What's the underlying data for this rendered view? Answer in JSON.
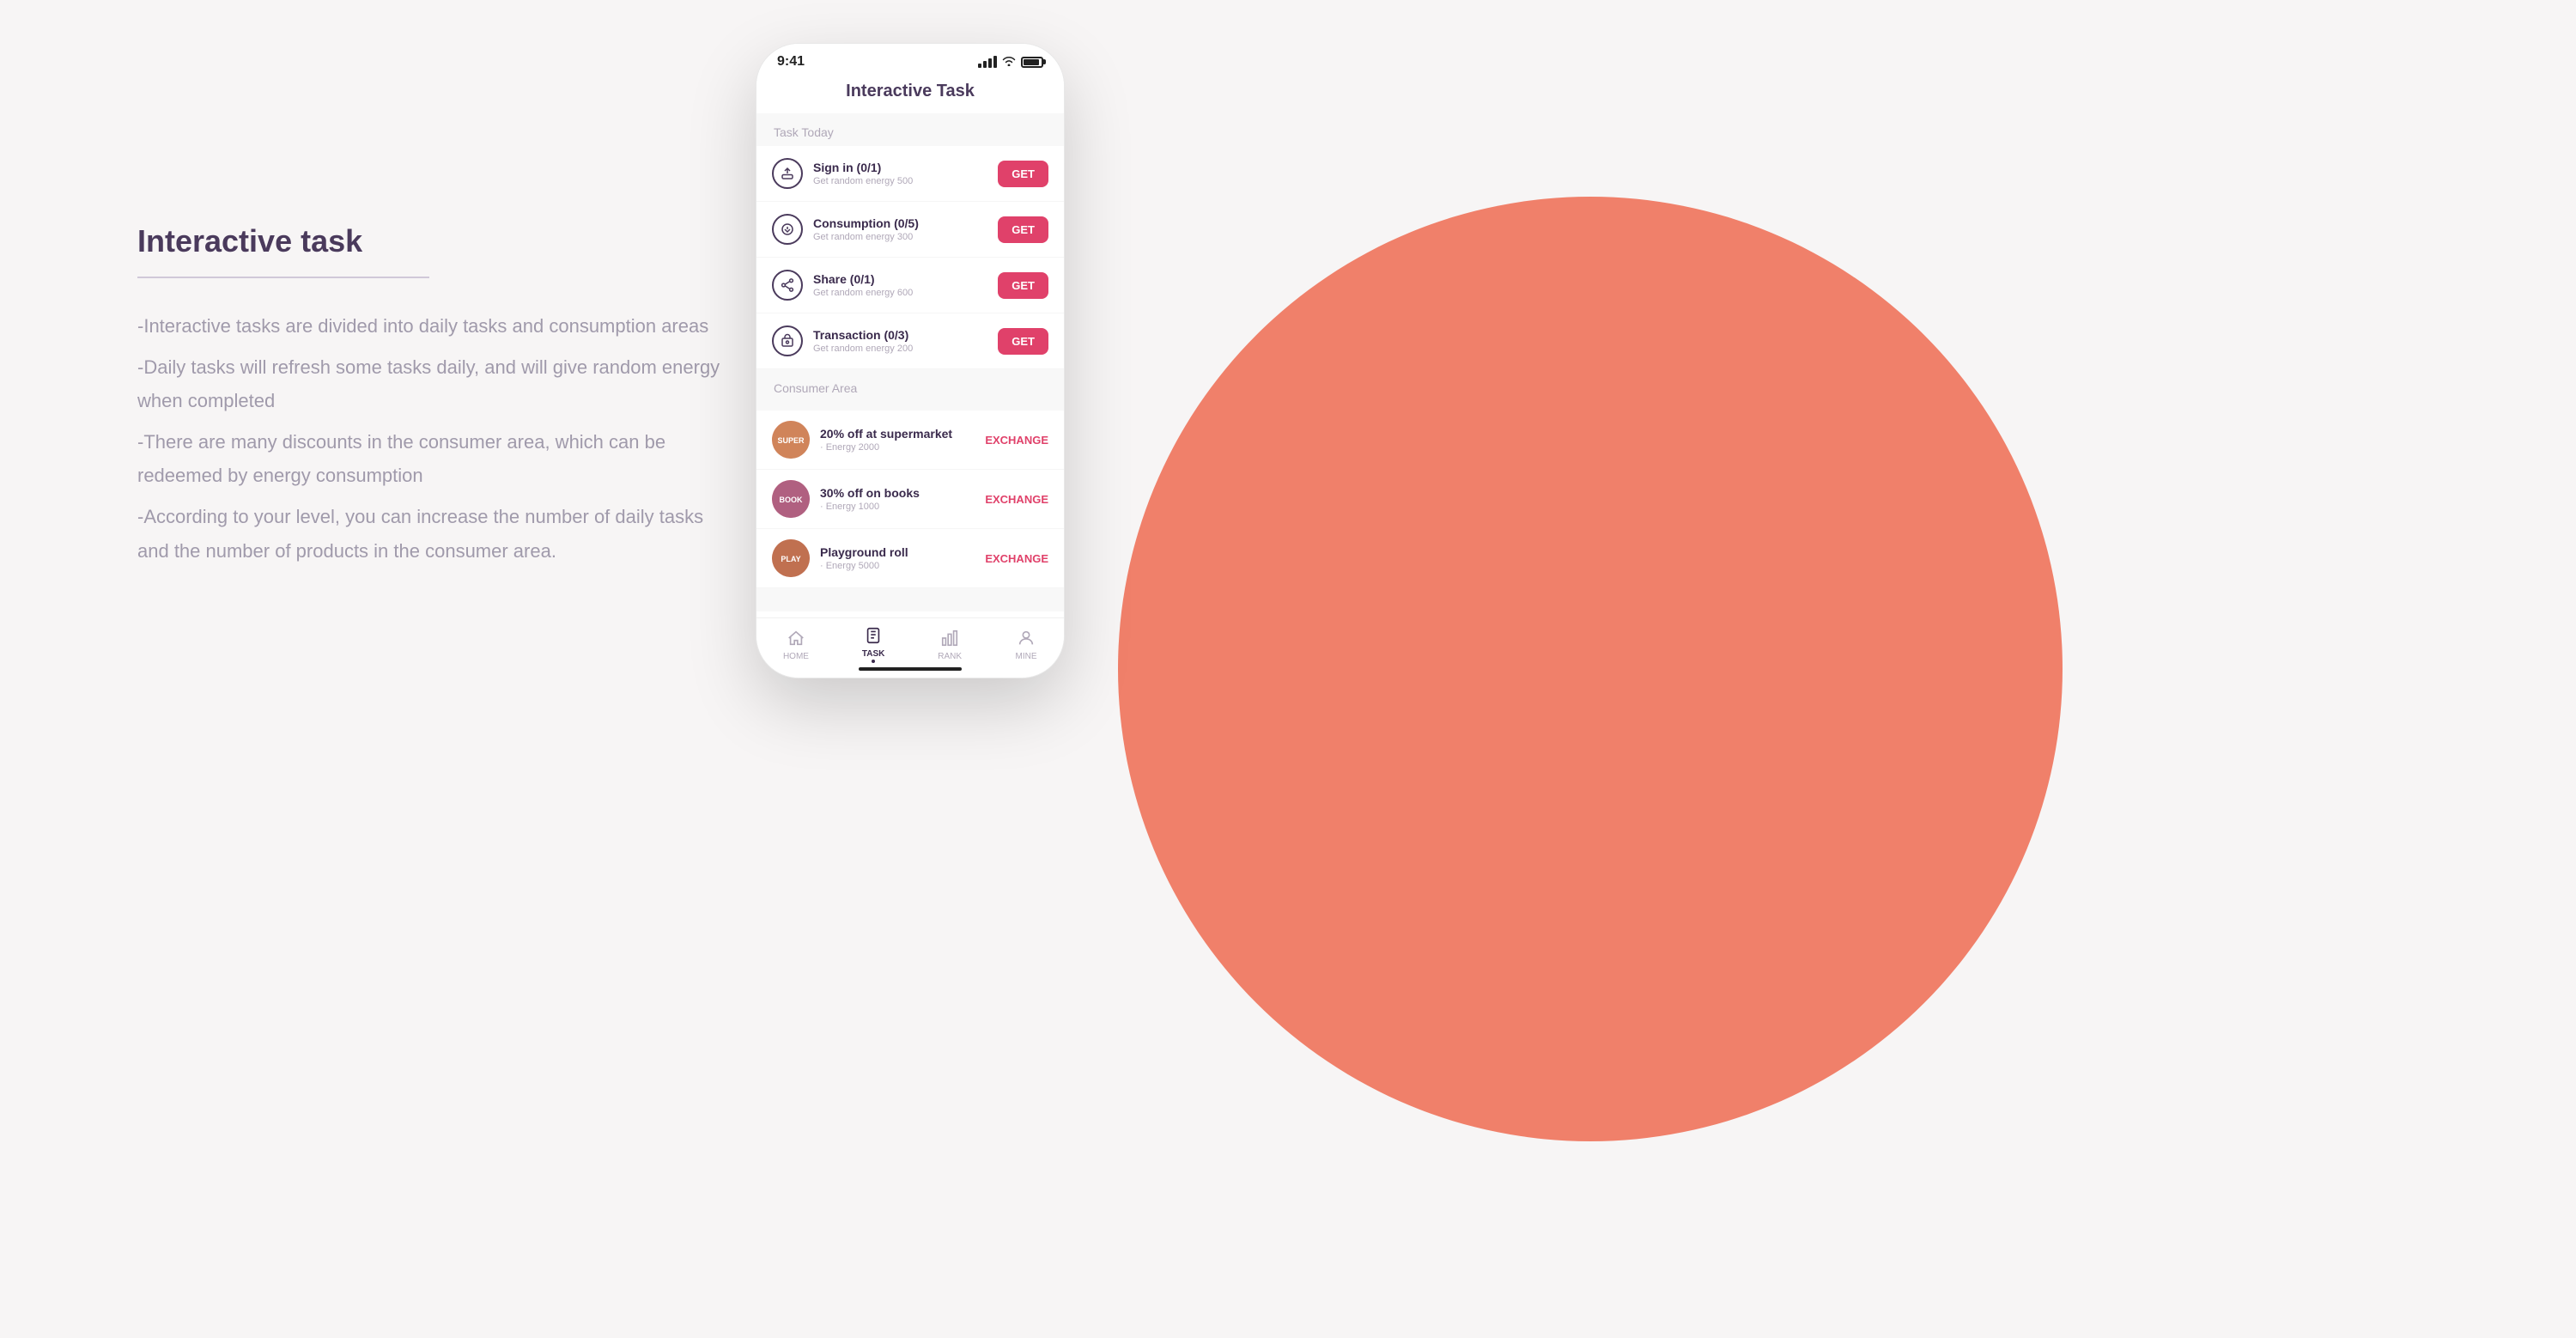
{
  "left": {
    "title": "Interactive task",
    "description_lines": [
      "-Interactive tasks are divided into daily tasks and consumption areas",
      "-Daily tasks will refresh some tasks daily, and will give random energy when completed",
      "-There are many discounts in the consumer area, which can be redeemed by energy consumption",
      "-According to your level, you can increase the number of daily tasks and the number of products in the consumer area."
    ]
  },
  "phone": {
    "status_time": "9:41",
    "app_title": "Interactive Task",
    "task_section_label": "Task Today",
    "tasks": [
      {
        "id": "signin",
        "name": "Sign in (0/1)",
        "desc": "Get random energy 500",
        "button": "GET"
      },
      {
        "id": "consumption",
        "name": "Consumption (0/5)",
        "desc": "Get random energy 300",
        "button": "GET"
      },
      {
        "id": "share",
        "name": "Share (0/1)",
        "desc": "Get random energy 600",
        "button": "GET"
      },
      {
        "id": "transaction",
        "name": "Transaction (0/3)",
        "desc": "Get random energy 200",
        "button": "GET"
      }
    ],
    "consumer_section_label": "Consumer Area",
    "consumer_items": [
      {
        "id": "supermarket",
        "name": "20% off at supermarket",
        "energy": "· Energy 2000",
        "button": "EXCHANGE"
      },
      {
        "id": "books",
        "name": "30% off on books",
        "energy": "· Energy 1000",
        "button": "EXCHANGE"
      },
      {
        "id": "playground",
        "name": "Playground roll",
        "energy": "· Energy 5000",
        "button": "EXCHANGE"
      }
    ],
    "nav": [
      {
        "id": "home",
        "label": "HOME",
        "active": false
      },
      {
        "id": "task",
        "label": "TASK",
        "active": true
      },
      {
        "id": "rank",
        "label": "RANK",
        "active": false
      },
      {
        "id": "mine",
        "label": "MINE",
        "active": false
      }
    ]
  }
}
